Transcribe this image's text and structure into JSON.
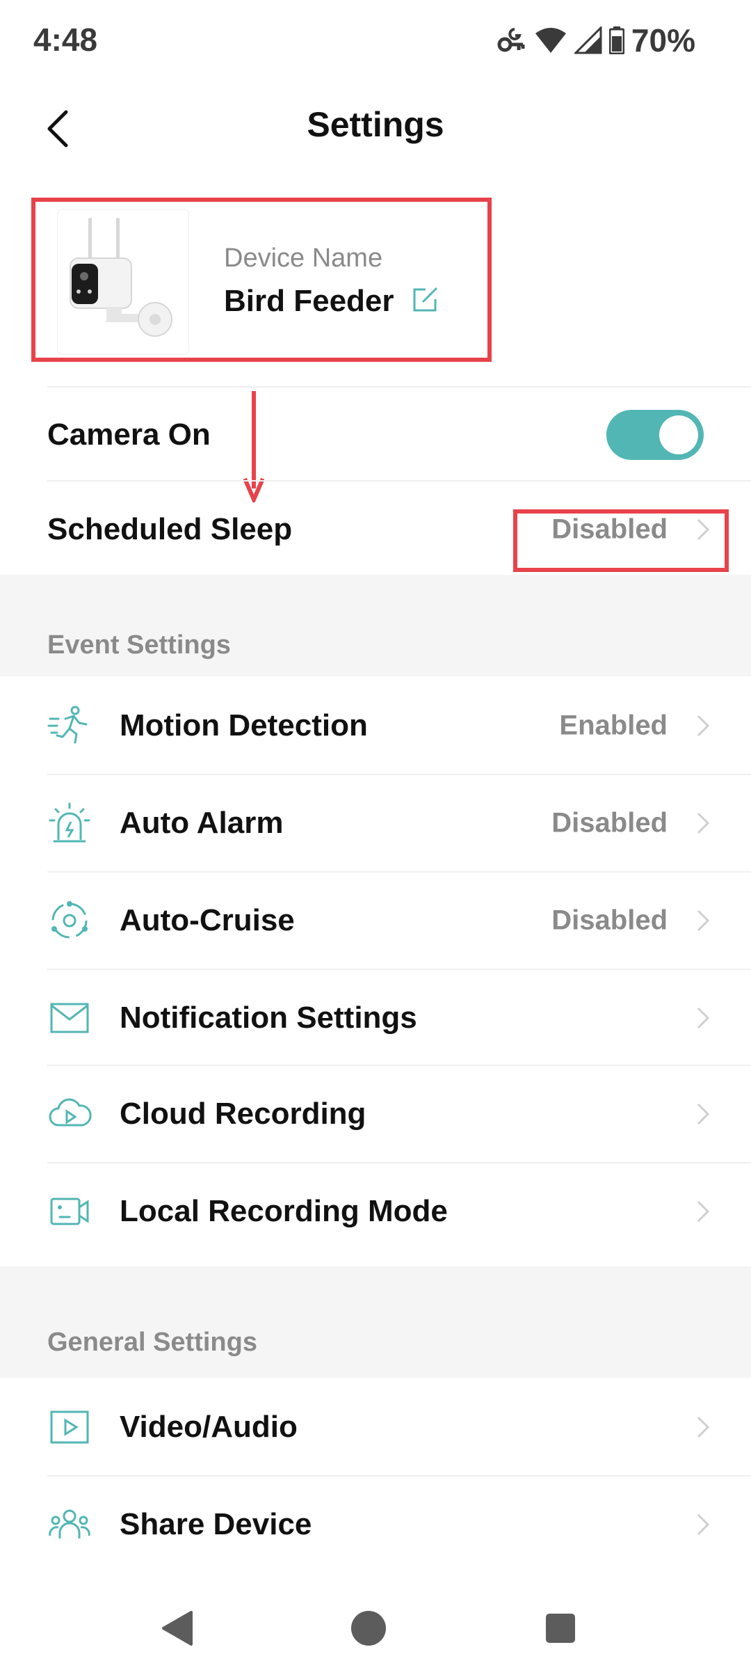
{
  "status_bar": {
    "time": "4:48",
    "battery": "70%",
    "icons": [
      "vpn-key-icon",
      "wifi-icon",
      "cellular-signal-icon",
      "battery-icon"
    ]
  },
  "header": {
    "title": "Settings",
    "back_icon": "back-chevron-icon"
  },
  "device": {
    "name_label": "Device Name",
    "name": "Bird Feeder",
    "edit_icon": "edit-icon"
  },
  "top_rows": [
    {
      "label": "Camera On",
      "control": "toggle",
      "toggle_on": true
    },
    {
      "label": "Scheduled Sleep",
      "value": "Disabled"
    }
  ],
  "event_settings": {
    "title": "Event Settings",
    "items": [
      {
        "label": "Motion Detection",
        "value": "Enabled",
        "icon": "motion-detection-icon"
      },
      {
        "label": "Auto Alarm",
        "value": "Disabled",
        "icon": "alarm-siren-icon"
      },
      {
        "label": "Auto-Cruise",
        "value": "Disabled",
        "icon": "auto-cruise-icon"
      },
      {
        "label": "Notification Settings",
        "value": "",
        "icon": "envelope-icon"
      },
      {
        "label": "Cloud Recording",
        "value": "",
        "icon": "cloud-play-icon"
      },
      {
        "label": "Local Recording Mode",
        "value": "",
        "icon": "camera-recording-icon"
      }
    ]
  },
  "general_settings": {
    "title": "General Settings",
    "items": [
      {
        "label": "Video/Audio",
        "value": "",
        "icon": "video-play-icon"
      },
      {
        "label": "Share Device",
        "value": "",
        "icon": "users-icon"
      }
    ]
  },
  "colors": {
    "accent": "#52b6b4",
    "annotation": "#e8424a",
    "secondary_text": "#8a8a8a",
    "section_background": "#f5f5f5"
  }
}
